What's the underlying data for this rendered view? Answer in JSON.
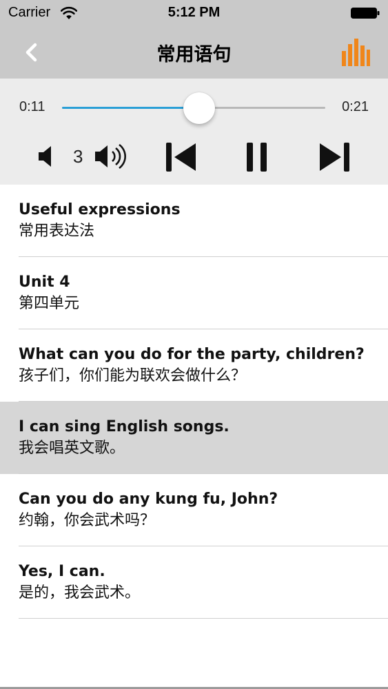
{
  "status_bar": {
    "carrier": "Carrier",
    "time": "5:12 PM",
    "icons": [
      "wifi-icon",
      "battery-icon"
    ]
  },
  "nav": {
    "title": "常用语句",
    "back_icon": "chevron-left-icon",
    "right_icon": "bar-chart-icon",
    "accent_color": "#f0861a"
  },
  "player": {
    "current_time": "0:11",
    "total_time": "0:21",
    "progress": 0.52,
    "track_color": "#2a9fd6",
    "volume": "3",
    "icons": [
      "volume-down-icon",
      "volume-up-icon",
      "skip-previous-icon",
      "pause-icon",
      "skip-next-icon"
    ]
  },
  "phrases": [
    {
      "en": "Useful expressions",
      "zh": "常用表达法",
      "selected": false
    },
    {
      "en": "Unit 4",
      "zh": "第四单元",
      "selected": false
    },
    {
      "en": "What can you do for the party, children?",
      "zh": "孩子们，你们能为联欢会做什么？",
      "selected": false
    },
    {
      "en": "I can sing English songs.",
      "zh": "我会唱英文歌。",
      "selected": true
    },
    {
      "en": "Can you do any kung fu, John?",
      "zh": "约翰，你会武术吗？",
      "selected": false
    },
    {
      "en": "Yes, I can.",
      "zh": "是的，我会武术。",
      "selected": false
    }
  ]
}
